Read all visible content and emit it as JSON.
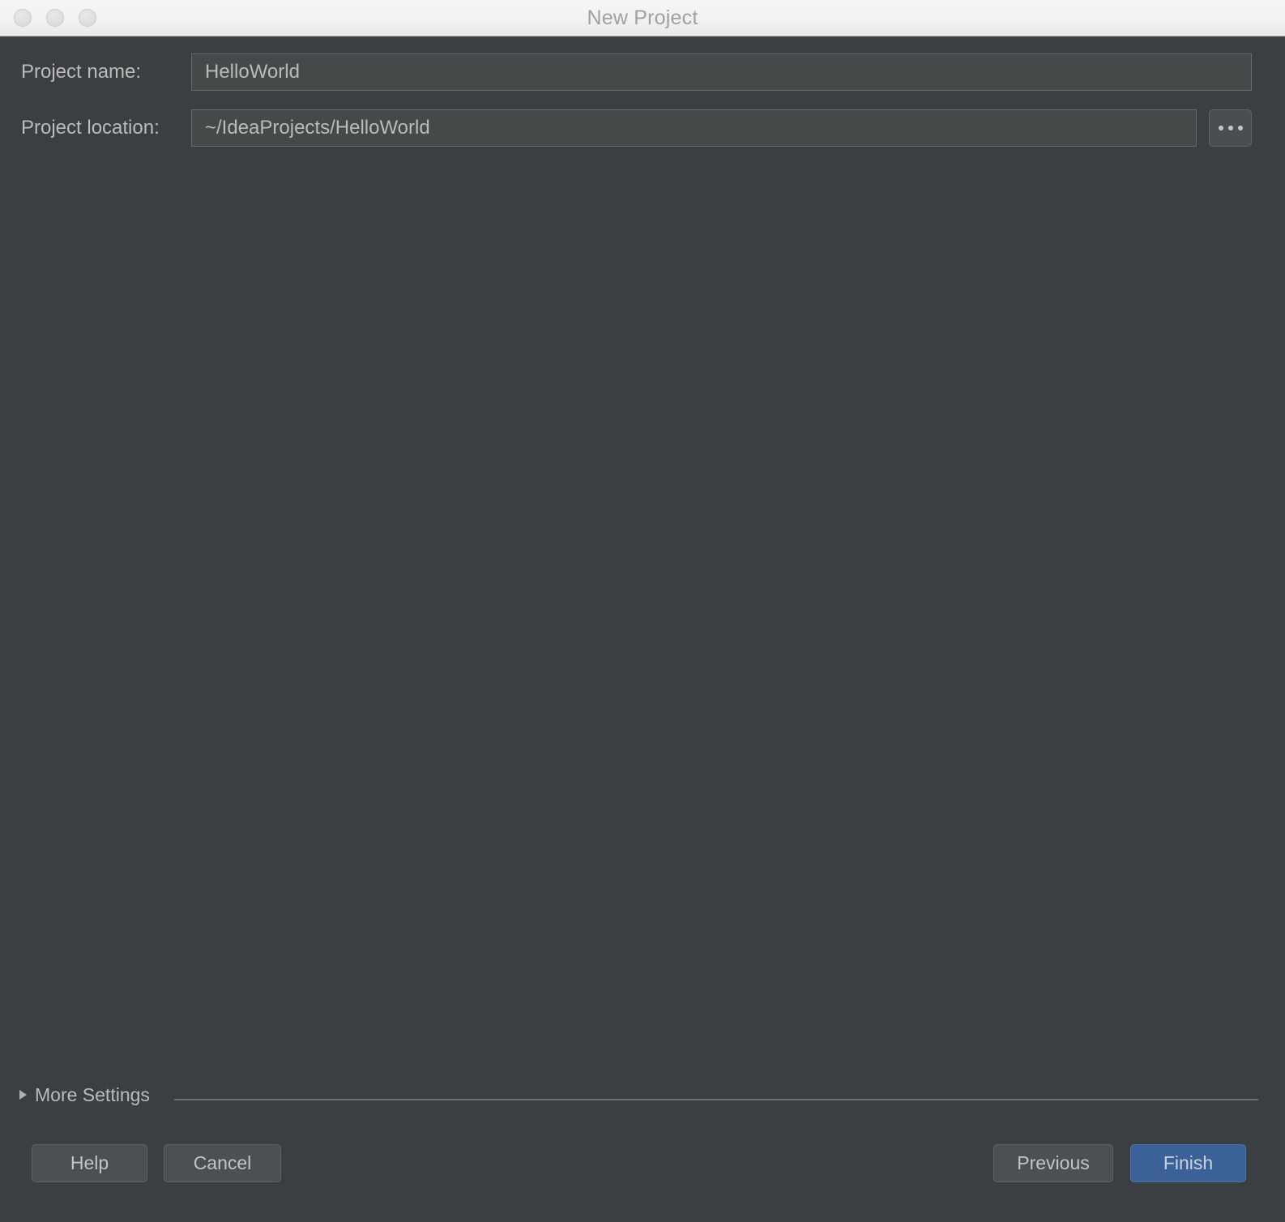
{
  "window": {
    "title": "New Project",
    "traffic_lights": [
      {
        "name": "close",
        "label": ""
      },
      {
        "name": "minimize",
        "label": ""
      },
      {
        "name": "zoom",
        "label": ""
      }
    ],
    "background_color": "#3c3f41",
    "titlebar_color": "#f1f1f1",
    "accent_color": "#3c6199"
  },
  "form": {
    "project_name": {
      "label": "Project name:",
      "value": "HelloWorld",
      "placeholder": ""
    },
    "project_location": {
      "label": "Project location:",
      "value": "~/IdeaProjects/HelloWorld",
      "placeholder": "",
      "browse_label": "..."
    }
  },
  "more_settings": {
    "label": "More Settings",
    "expanded": false
  },
  "footer": {
    "help_label": "Help",
    "cancel_label": "Cancel",
    "previous_label": "Previous",
    "finish_label": "Finish"
  }
}
